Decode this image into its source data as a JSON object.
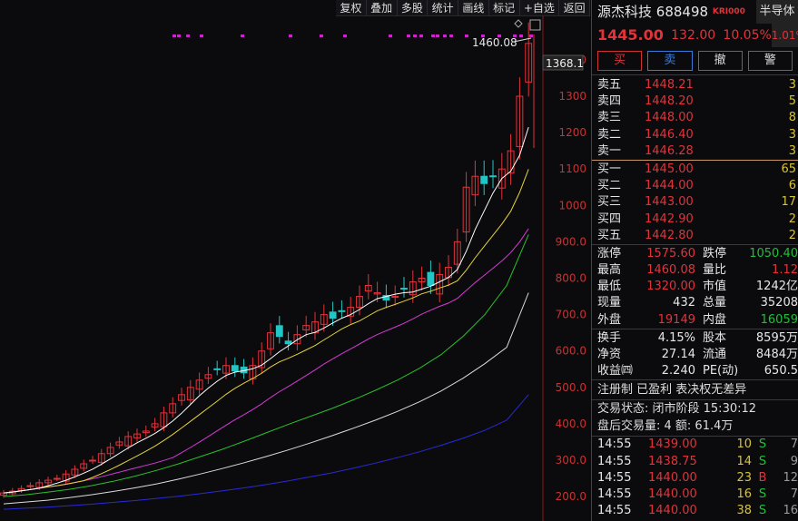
{
  "toolbar": [
    "复权",
    "叠加",
    "多股",
    "统计",
    "画线",
    "标记",
    "+自选",
    "返回"
  ],
  "header": {
    "name": "源杰科技",
    "code": "688498",
    "badge": "KRI000",
    "sector": "半导体",
    "price": "1445.00",
    "change": "132.00",
    "pct": "10.05%",
    "sector_pct": "1.01%"
  },
  "buttons": {
    "buy": "买",
    "sell": "卖",
    "cancel": "撤",
    "alert": "警"
  },
  "asks": [
    {
      "l": "卖五",
      "p": "1448.21",
      "v": "3"
    },
    {
      "l": "卖四",
      "p": "1448.20",
      "v": "5"
    },
    {
      "l": "卖三",
      "p": "1448.00",
      "v": "8"
    },
    {
      "l": "卖二",
      "p": "1446.40",
      "v": "3"
    },
    {
      "l": "卖一",
      "p": "1446.28",
      "v": "3"
    }
  ],
  "bids": [
    {
      "l": "买一",
      "p": "1445.00",
      "v": "65"
    },
    {
      "l": "买二",
      "p": "1444.00",
      "v": "6"
    },
    {
      "l": "买三",
      "p": "1443.00",
      "v": "17"
    },
    {
      "l": "买四",
      "p": "1442.90",
      "v": "2"
    },
    {
      "l": "买五",
      "p": "1442.80",
      "v": "2"
    }
  ],
  "stats1": [
    [
      "涨停",
      "1575.60",
      "跌停",
      "1050.40"
    ],
    [
      "最高",
      "1460.08",
      "量比",
      "1.12"
    ],
    [
      "最低",
      "1320.00",
      "市值",
      "1242亿"
    ],
    [
      "现量",
      "432",
      "总量",
      "35208"
    ],
    [
      "外盘",
      "19149",
      "内盘",
      "16059"
    ]
  ],
  "stats2": [
    [
      "换手",
      "4.15%",
      "股本",
      "8595万"
    ],
    [
      "净资",
      "27.14",
      "流通",
      "8484万"
    ],
    [
      "收益㈣",
      "2.240",
      "PE(动)",
      "650.5"
    ]
  ],
  "tags": "注册制 已盈利 表决权无差异",
  "status": "交易状态: 闭市阶段 15:30:12",
  "after": "盘后交易量: 4  额: 61.4万",
  "ticks": [
    {
      "t": "14:55",
      "p": "1439.00",
      "v": "10",
      "d": "S",
      "n": "7"
    },
    {
      "t": "14:55",
      "p": "1438.75",
      "v": "14",
      "d": "S",
      "n": "9"
    },
    {
      "t": "14:55",
      "p": "1440.00",
      "v": "23",
      "d": "B",
      "n": "12"
    },
    {
      "t": "14:55",
      "p": "1440.00",
      "v": "16",
      "d": "S",
      "n": "7"
    },
    {
      "t": "14:55",
      "p": "1440.00",
      "v": "38",
      "d": "S",
      "n": "16"
    }
  ],
  "chart_data": {
    "type": "candlestick",
    "high_label": "1460.08",
    "current_label": "1368.1",
    "yticks": [
      1400,
      1300,
      1200,
      1100,
      1000,
      900,
      800,
      700,
      600,
      500,
      400,
      300,
      200
    ],
    "ytick_labels": [
      "1400",
      "1300",
      "1200",
      "1100",
      "1000",
      "900.0",
      "800.0",
      "700.0",
      "600.0",
      "500.0",
      "400.0",
      "300.0",
      "200.0"
    ],
    "closes": [
      210,
      215,
      222,
      230,
      238,
      245,
      250,
      262,
      275,
      290,
      300,
      318,
      335,
      350,
      365,
      372,
      380,
      400,
      430,
      455,
      480,
      500,
      520,
      535,
      550,
      560,
      545,
      540,
      560,
      600,
      650,
      640,
      620,
      645,
      670,
      680,
      700,
      690,
      710,
      720,
      750,
      780,
      760,
      740,
      750,
      770,
      790,
      800,
      780,
      810,
      830,
      900,
      1050,
      1080,
      1060,
      1080,
      1100,
      1150,
      1300,
      1445
    ],
    "ma60": [
      200,
      205,
      212,
      220,
      230,
      242,
      256,
      272,
      290,
      310,
      330,
      352,
      375,
      398,
      420,
      442,
      466,
      492,
      520,
      552,
      590,
      640,
      700,
      780,
      920
    ],
    "ma120": [
      180,
      185,
      190,
      197,
      205,
      214,
      224,
      235,
      248,
      262,
      277,
      293,
      310,
      328,
      347,
      367,
      388,
      410,
      434,
      460,
      490,
      525,
      565,
      610,
      760
    ],
    "ma250": [
      165,
      168,
      171,
      175,
      179,
      184,
      189,
      195,
      201,
      208,
      216,
      224,
      233,
      243,
      254,
      265,
      278,
      292,
      307,
      323,
      341,
      360,
      382,
      410,
      480
    ],
    "colors": {
      "up": "#e2323a",
      "down": "#21c6c6",
      "ma5": "#ffffff",
      "ma10": "#e6d23a",
      "ma20": "#d63ad6",
      "ma60": "#2ac02a",
      "ma120": "#dcdcdc",
      "ma250": "#2a2ad8"
    }
  }
}
